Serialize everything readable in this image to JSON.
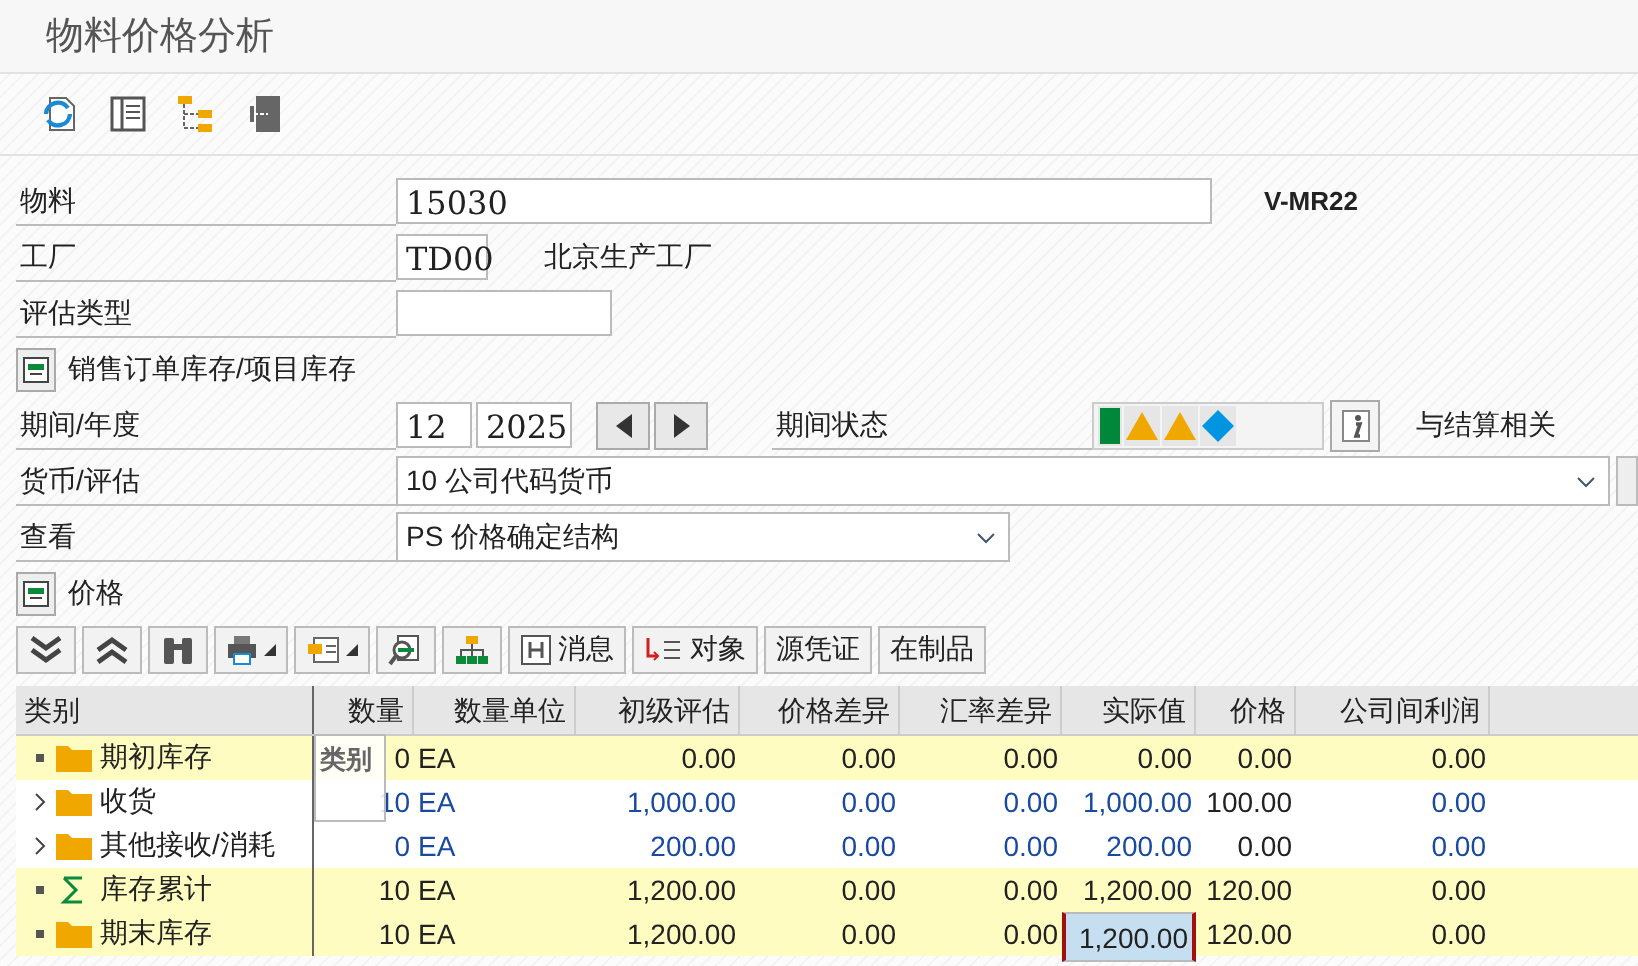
{
  "window": {
    "title": "物料价格分析"
  },
  "material": {
    "label": "物料",
    "value": "15030",
    "code": "V-MR22"
  },
  "plant": {
    "label": "工厂",
    "value": "TD00",
    "description": "北京生产工厂"
  },
  "valuation_type": {
    "label": "评估类型"
  },
  "sales_order_button": {
    "label": "销售订单库存/项目库存"
  },
  "period": {
    "label": "期间/年度",
    "period": "12",
    "year": "2025"
  },
  "period_status": {
    "label": "期间状态",
    "lights": [
      {
        "kind": "square",
        "color": "#00883a"
      },
      {
        "kind": "triangle",
        "color": "#f0a800"
      },
      {
        "kind": "triangle",
        "color": "#f0a800"
      },
      {
        "kind": "diamond",
        "color": "#0095e0"
      }
    ],
    "note": "与结算相关"
  },
  "currency": {
    "label": "货币/评估",
    "value": "10 公司代码货币"
  },
  "view": {
    "label": "查看",
    "value": "PS 价格确定结构"
  },
  "price_button": {
    "label": "价格"
  },
  "grid_toolbar": [
    {
      "kind": "icon-text",
      "label": "消息"
    },
    {
      "kind": "icon-text",
      "label": "对象"
    },
    {
      "kind": "text",
      "label": "源凭证"
    },
    {
      "kind": "text",
      "label": "在制品"
    }
  ],
  "table": {
    "columns": [
      {
        "label": "类别",
        "kind": "tree"
      },
      {
        "label": "数量",
        "kind": "amount"
      },
      {
        "label": "数量单位",
        "kind": "unit"
      },
      {
        "label": "初级评估",
        "kind": "amount"
      },
      {
        "label": "价格差异",
        "kind": "amount"
      },
      {
        "label": "汇率差异",
        "kind": "amount"
      },
      {
        "label": "实际值",
        "kind": "amount"
      },
      {
        "label": "价格",
        "kind": "price"
      },
      {
        "label": "公司间利润",
        "kind": "amount"
      }
    ],
    "rows": [
      {
        "expandable": false,
        "highlighted": true,
        "kind": "folder",
        "cells": [
          {
            "text": "期初库存",
            "selected": false
          },
          {
            "text": "0",
            "selected": false
          },
          {
            "text": "EA",
            "selected": false
          },
          {
            "text": "0.00",
            "selected": false
          },
          {
            "text": "0.00",
            "selected": false
          },
          {
            "text": "0.00",
            "selected": false
          },
          {
            "text": "0.00",
            "selected": false
          },
          {
            "text": "0.00",
            "selected": false
          },
          {
            "text": "0.00",
            "selected": false
          }
        ]
      },
      {
        "expandable": true,
        "highlighted": false,
        "kind": "folder",
        "cells": [
          {
            "text": "收货",
            "selected": false
          },
          {
            "text": "10",
            "selected": false
          },
          {
            "text": "EA",
            "selected": false
          },
          {
            "text": "1,000.00",
            "selected": false
          },
          {
            "text": "0.00",
            "selected": false
          },
          {
            "text": "0.00",
            "selected": false
          },
          {
            "text": "1,000.00",
            "selected": false
          },
          {
            "text": "100.00",
            "selected": false
          },
          {
            "text": "0.00",
            "selected": false
          }
        ]
      },
      {
        "expandable": true,
        "highlighted": false,
        "kind": "folder",
        "cells": [
          {
            "text": "其他接收/消耗",
            "selected": false
          },
          {
            "text": "0",
            "selected": false
          },
          {
            "text": "EA",
            "selected": false
          },
          {
            "text": "200.00",
            "selected": false
          },
          {
            "text": "0.00",
            "selected": false
          },
          {
            "text": "0.00",
            "selected": false
          },
          {
            "text": "200.00",
            "selected": false
          },
          {
            "text": "0.00",
            "selected": false
          },
          {
            "text": "0.00",
            "selected": false
          }
        ]
      },
      {
        "expandable": false,
        "highlighted": true,
        "kind": "sum",
        "cells": [
          {
            "text": "库存累计",
            "selected": false
          },
          {
            "text": "10",
            "selected": false
          },
          {
            "text": "EA",
            "selected": false
          },
          {
            "text": "1,200.00",
            "selected": false
          },
          {
            "text": "0.00",
            "selected": false
          },
          {
            "text": "0.00",
            "selected": false
          },
          {
            "text": "1,200.00",
            "selected": false
          },
          {
            "text": "120.00",
            "selected": false
          },
          {
            "text": "0.00",
            "selected": false
          }
        ]
      },
      {
        "expandable": false,
        "highlighted": true,
        "kind": "folder",
        "cells": [
          {
            "text": "期末库存",
            "selected": false
          },
          {
            "text": "10",
            "selected": false
          },
          {
            "text": "EA",
            "selected": false
          },
          {
            "text": "1,200.00",
            "selected": false
          },
          {
            "text": "0.00",
            "selected": false
          },
          {
            "text": "0.00",
            "selected": false
          },
          {
            "text": "1,200.00",
            "selected": true
          },
          {
            "text": "120.00",
            "selected": false
          },
          {
            "text": "0.00",
            "selected": false
          }
        ]
      }
    ]
  },
  "tooltip": {
    "text": "类别"
  }
}
